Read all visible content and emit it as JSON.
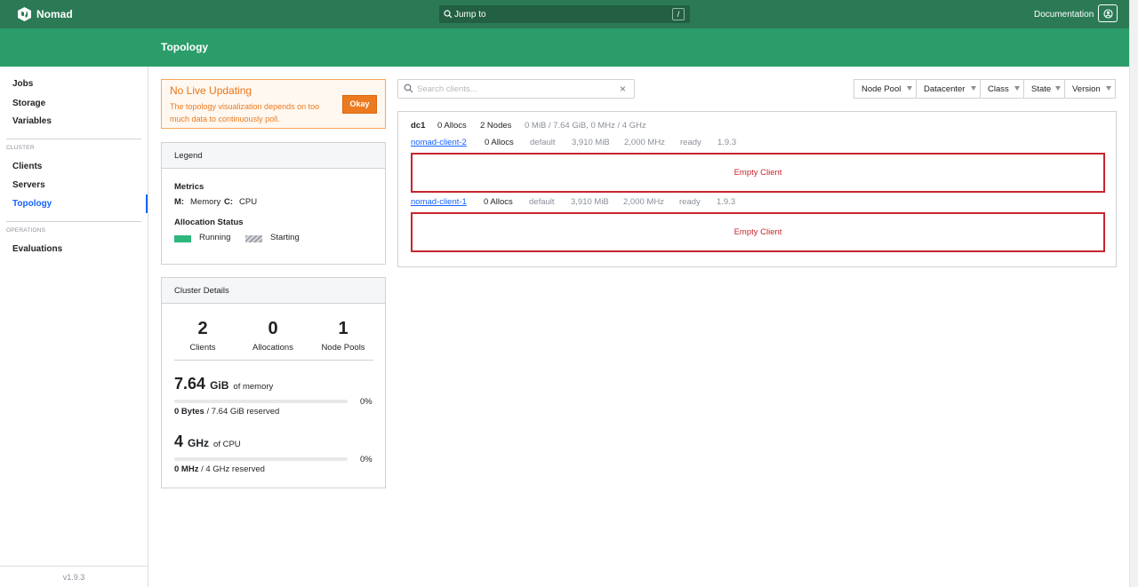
{
  "nav": {
    "brand": "Nomad",
    "jump_to": "Jump to",
    "jump_key": "/",
    "documentation": "Documentation"
  },
  "page": {
    "title": "Topology"
  },
  "sidebar": {
    "items": [
      {
        "label": "Jobs"
      },
      {
        "label": "Storage"
      },
      {
        "label": "Variables"
      }
    ],
    "cluster_label": "CLUSTER",
    "cluster_items": [
      {
        "label": "Clients"
      },
      {
        "label": "Servers"
      },
      {
        "label": "Topology",
        "active": true
      }
    ],
    "operations_label": "OPERATIONS",
    "operations_items": [
      {
        "label": "Evaluations"
      }
    ],
    "version": "v1.9.3"
  },
  "warning": {
    "title": "No Live Updating",
    "message": "The topology visualization depends on too much data to continuously poll.",
    "button": "Okay"
  },
  "legend": {
    "header": "Legend",
    "metrics_label": "Metrics",
    "memory_key": "M:",
    "memory_label": "Memory",
    "cpu_key": "C:",
    "cpu_label": "CPU",
    "status_label": "Allocation Status",
    "running": "Running",
    "starting": "Starting",
    "running_color": "#2eb67d"
  },
  "cluster_details": {
    "header": "Cluster Details",
    "clients": {
      "value": "2",
      "label": "Clients"
    },
    "allocations": {
      "value": "0",
      "label": "Allocations"
    },
    "node_pools": {
      "value": "1",
      "label": "Node Pools"
    },
    "memory": {
      "value": "7.64",
      "unit": "GiB",
      "of": "of memory",
      "percent": "0%",
      "fill_fraction": 0,
      "reserved_bold": "0 Bytes",
      "reserved_rest": "/ 7.64 GiB reserved"
    },
    "cpu": {
      "value": "4",
      "unit": "GHz",
      "of": "of CPU",
      "percent": "0%",
      "fill_fraction": 0,
      "reserved_bold": "0 MHz",
      "reserved_rest": "/ 4 GHz reserved"
    }
  },
  "search": {
    "placeholder": "Search clients..."
  },
  "filters": [
    "Node Pool",
    "Datacenter",
    "Class",
    "State",
    "Version"
  ],
  "topology": {
    "datacenter": {
      "name": "dc1",
      "allocs": "0 Allocs",
      "nodes": "2 Nodes",
      "resources": "0 MiB / 7.64 GiB, 0 MHz / 4 GHz"
    },
    "nodes": [
      {
        "name": "nomad-client-2",
        "allocs": "0 Allocs",
        "pool": "default",
        "memory": "3,910 MiB",
        "cpu": "2,000 MHz",
        "status": "ready",
        "version": "1.9.3",
        "empty_label": "Empty Client"
      },
      {
        "name": "nomad-client-1",
        "allocs": "0 Allocs",
        "pool": "default",
        "memory": "3,910 MiB",
        "cpu": "2,000 MHz",
        "status": "ready",
        "version": "1.9.3",
        "empty_label": "Empty Client"
      }
    ]
  }
}
